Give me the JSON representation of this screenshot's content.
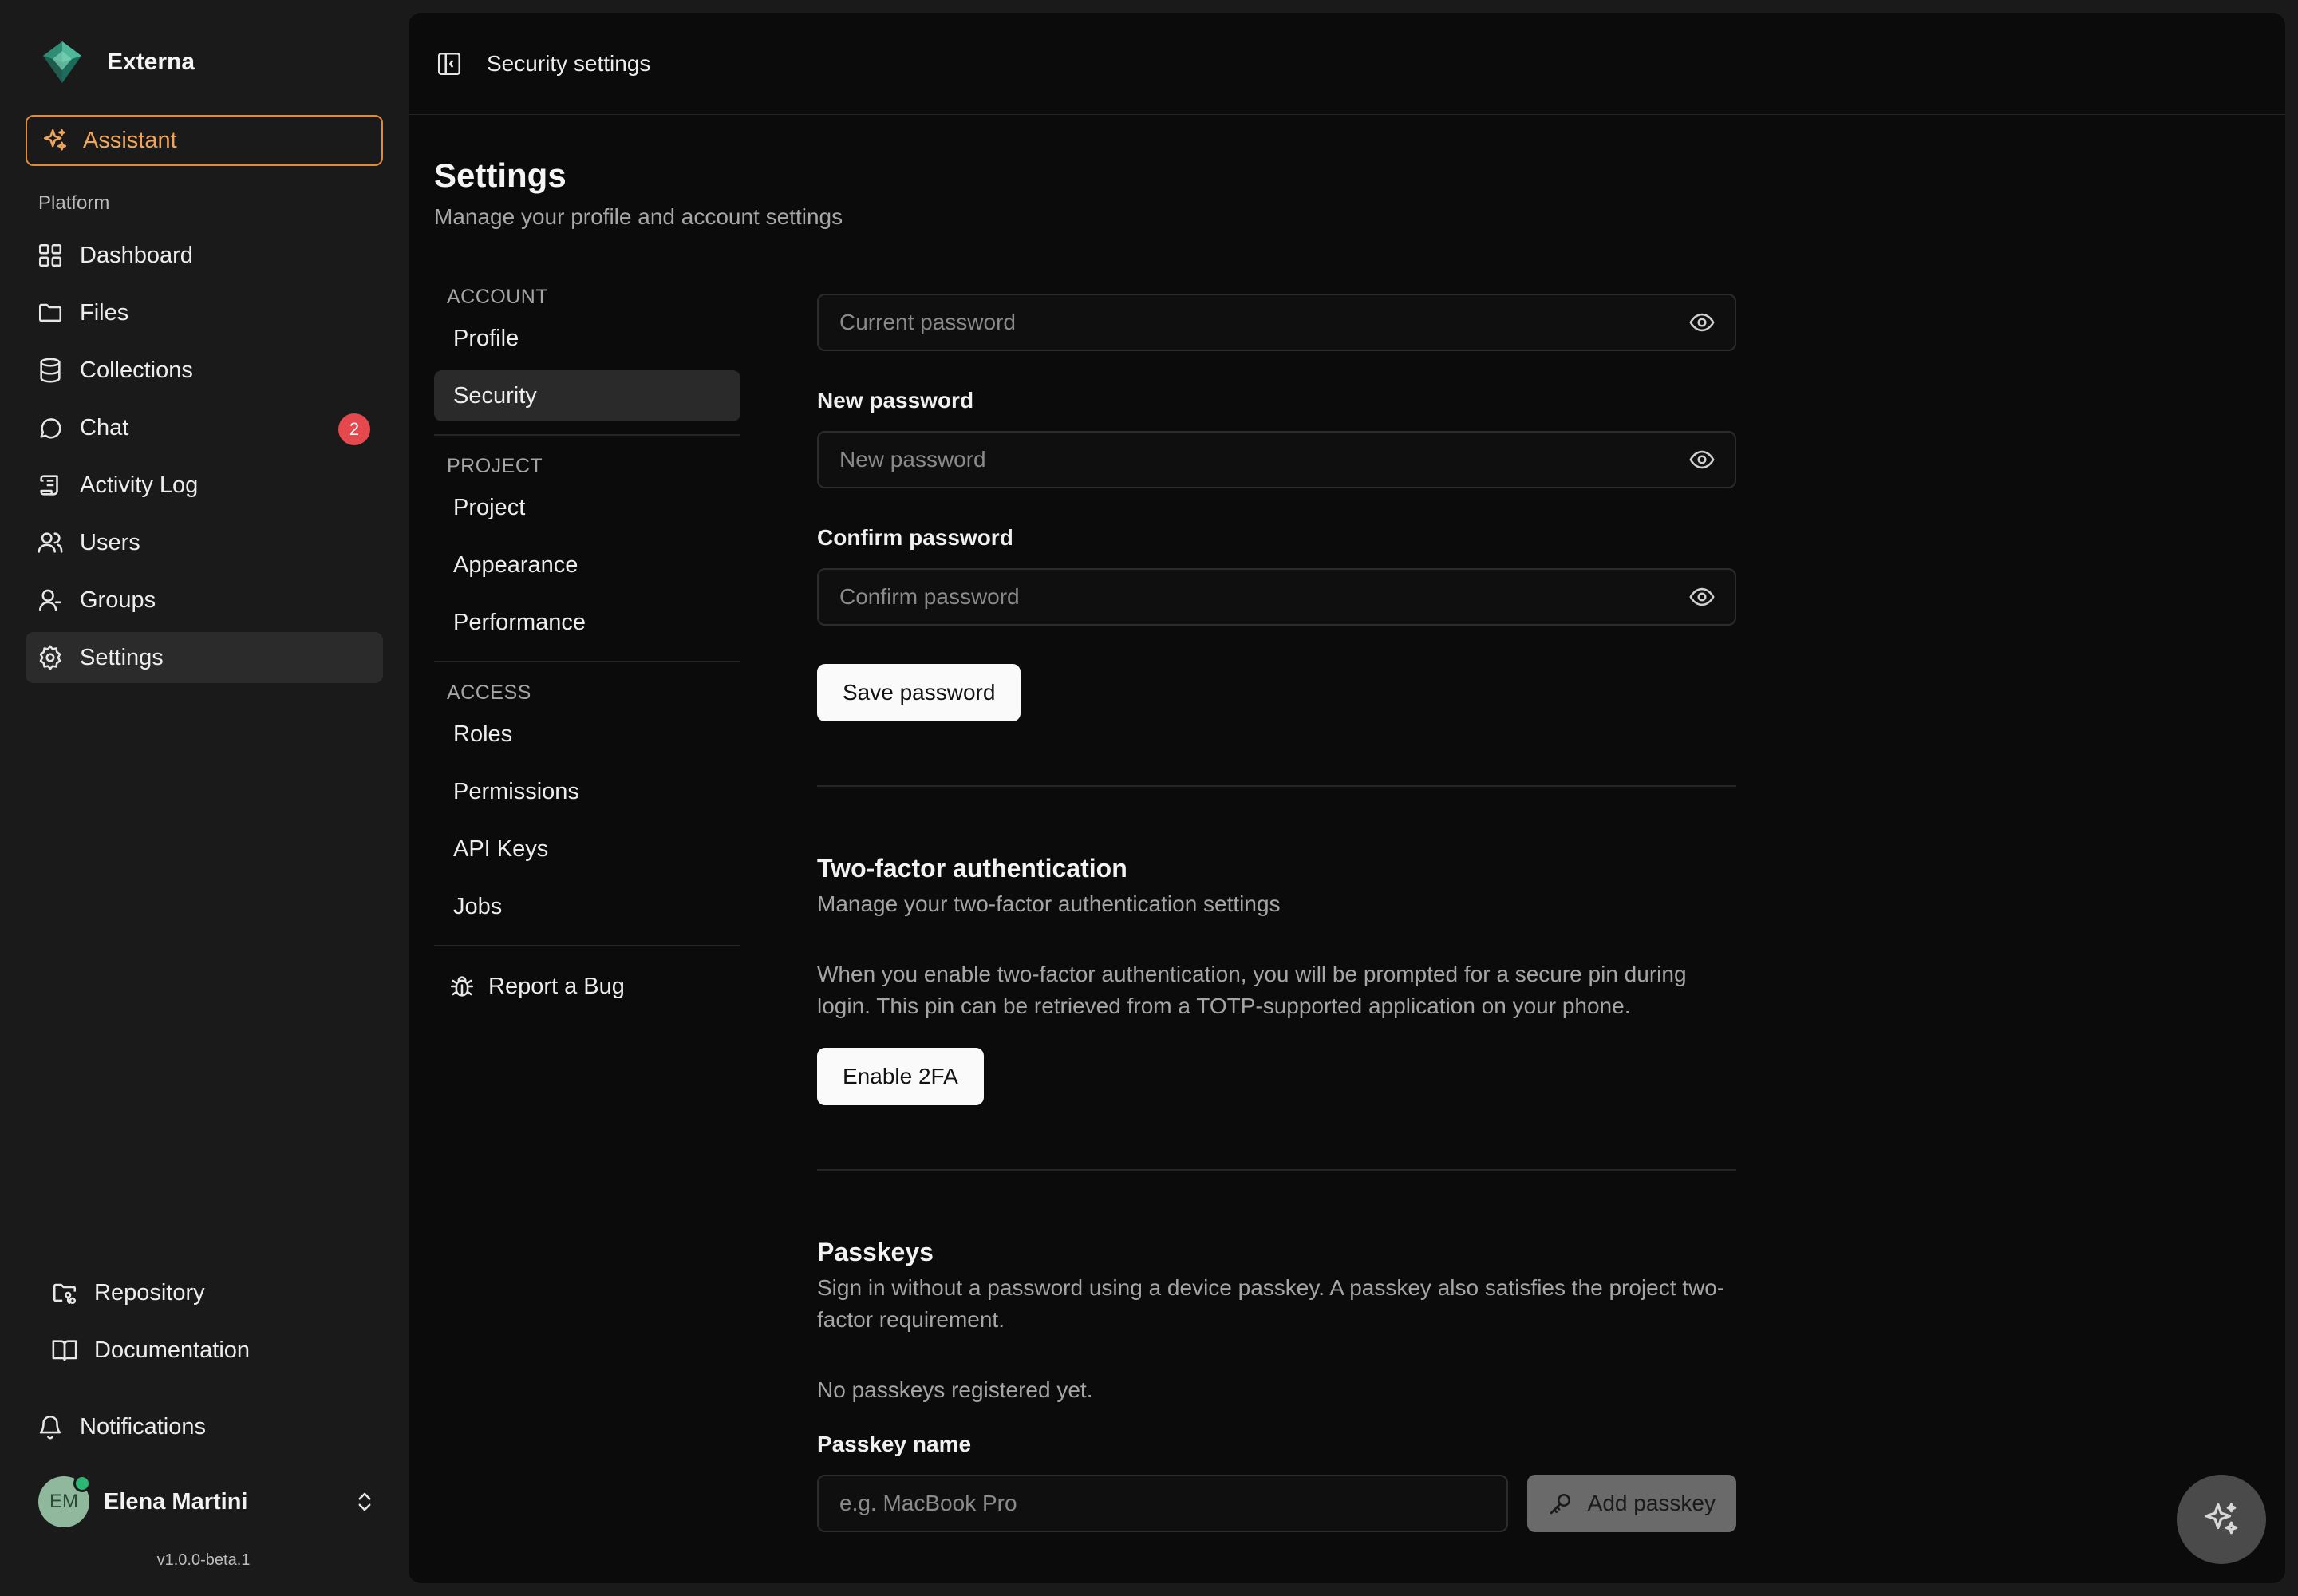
{
  "brand": {
    "name": "Externa"
  },
  "sidebar": {
    "assistant_label": "Assistant",
    "section_label": "Platform",
    "items": [
      {
        "label": "Dashboard",
        "icon": "grid-icon"
      },
      {
        "label": "Files",
        "icon": "folder-icon"
      },
      {
        "label": "Collections",
        "icon": "database-icon"
      },
      {
        "label": "Chat",
        "icon": "chat-icon",
        "badge": "2"
      },
      {
        "label": "Activity Log",
        "icon": "scroll-icon"
      },
      {
        "label": "Users",
        "icon": "users-icon"
      },
      {
        "label": "Groups",
        "icon": "group-icon"
      },
      {
        "label": "Settings",
        "icon": "gear-icon",
        "active": true
      }
    ],
    "bottom_links": [
      {
        "label": "Repository",
        "icon": "repo-icon"
      },
      {
        "label": "Documentation",
        "icon": "book-icon"
      }
    ],
    "notifications_label": "Notifications",
    "user": {
      "initials": "EM",
      "name": "Elena Martini"
    },
    "version": "v1.0.0-beta.1"
  },
  "topbar": {
    "title": "Security settings"
  },
  "page": {
    "title": "Settings",
    "subtitle": "Manage your profile and account settings"
  },
  "settings_nav": {
    "account_head": "ACCOUNT",
    "account_items": [
      "Profile",
      "Security"
    ],
    "project_head": "PROJECT",
    "project_items": [
      "Project",
      "Appearance",
      "Performance"
    ],
    "access_head": "ACCESS",
    "access_items": [
      "Roles",
      "Permissions",
      "API Keys",
      "Jobs"
    ],
    "report_bug": "Report a Bug"
  },
  "password": {
    "current_placeholder": "Current password",
    "new_label": "New password",
    "new_placeholder": "New password",
    "confirm_label": "Confirm password",
    "confirm_placeholder": "Confirm password",
    "save_label": "Save password"
  },
  "twofa": {
    "title": "Two-factor authentication",
    "subtitle": "Manage your two-factor authentication settings",
    "description": "When you enable two-factor authentication, you will be prompted for a secure pin during login. This pin can be retrieved from a TOTP-supported application on your phone.",
    "enable_label": "Enable 2FA"
  },
  "passkeys": {
    "title": "Passkeys",
    "description": "Sign in without a password using a device passkey. A passkey also satisfies the project two-factor requirement.",
    "empty_text": "No passkeys registered yet.",
    "name_label": "Passkey name",
    "name_placeholder": "e.g. MacBook Pro",
    "add_label": "Add passkey"
  },
  "colors": {
    "accent": "#e08a3c",
    "badge": "#e5484d",
    "background": "#0b0b0b",
    "sidebar": "#1a1a1a"
  }
}
